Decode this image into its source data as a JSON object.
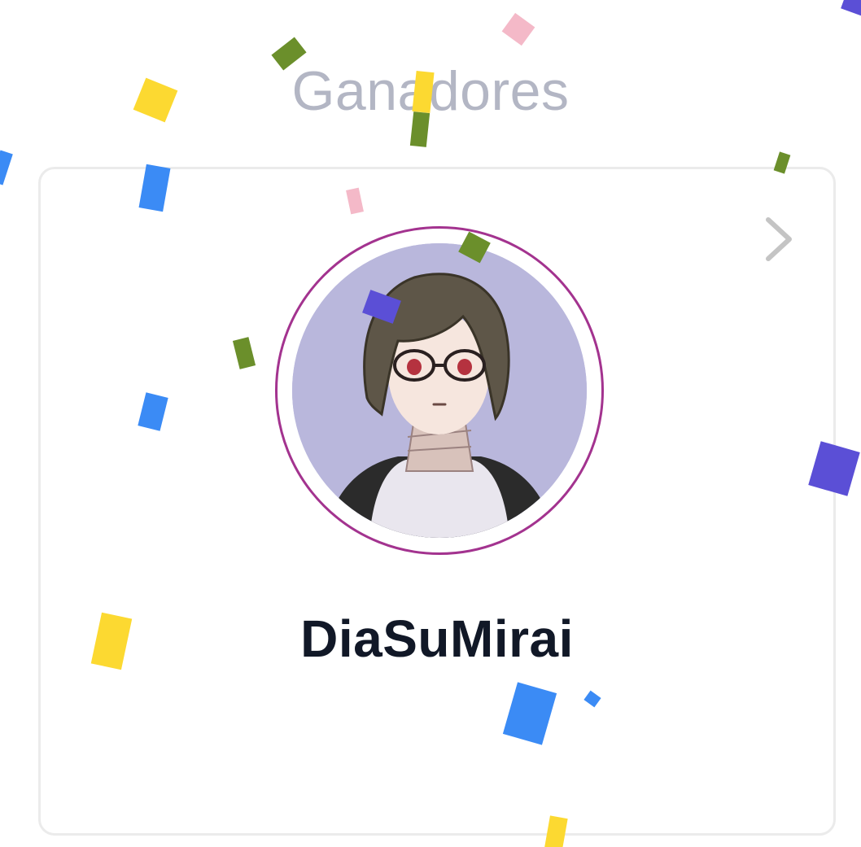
{
  "header": {
    "title": "Ganadores"
  },
  "winner_card": {
    "username": "DiaSuMirai",
    "avatar_alt": "Avatar",
    "chevron_icon": "chevron-right-icon",
    "avatar_ring_color": "#a3338f"
  },
  "colors": {
    "title": "#b3b6c4",
    "username": "#111827",
    "card_border": "#ebebeb",
    "confetti": [
      "#fcd931",
      "#3b8bf5",
      "#5b4fd6",
      "#6b8f2b",
      "#f4b9c8"
    ]
  }
}
